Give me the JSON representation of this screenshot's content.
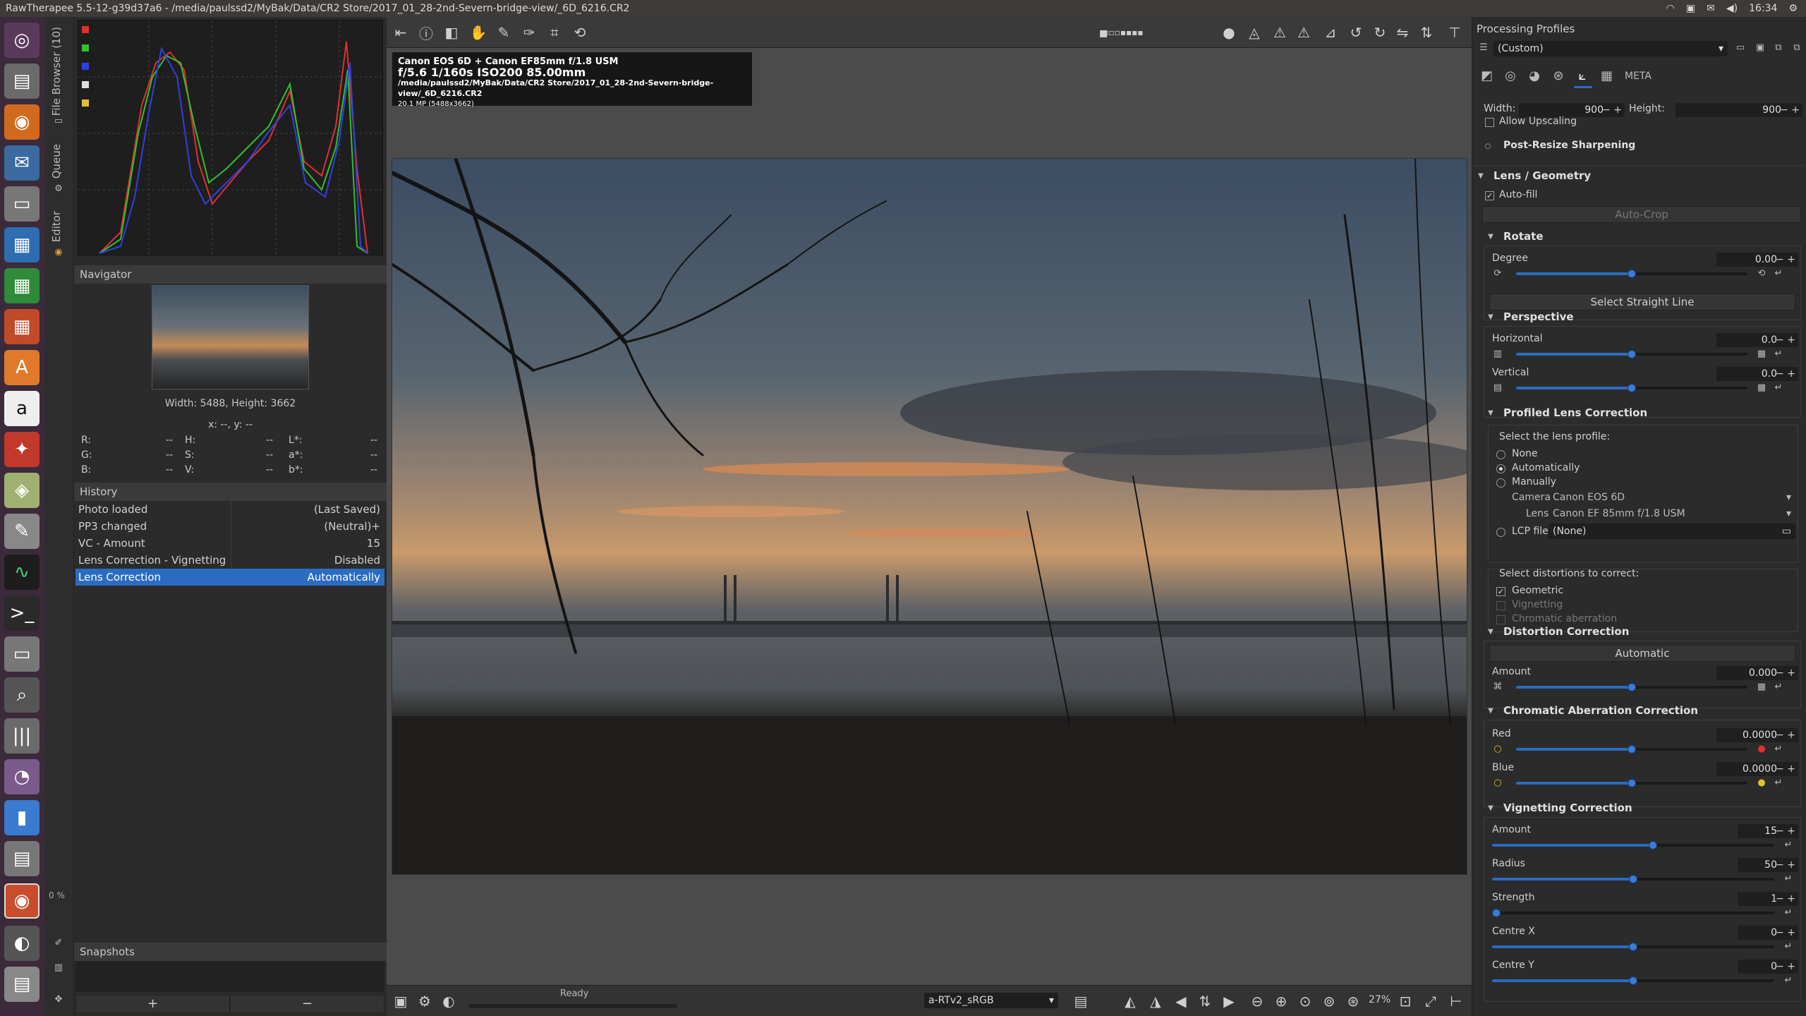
{
  "window": {
    "title": "RawTherapee 5.5-12-g39d37a6 - /media/paulssd2/MyBak/Data/CR2 Store/2017_01_28-2nd-Severn-bridge-view/_6D_6216.CR2",
    "clock": "16:34"
  },
  "vtabs": {
    "file_browser": "File Browser (10)",
    "queue": "Queue",
    "editor": "Editor",
    "percent": "0 %"
  },
  "navigator": {
    "header": "Navigator",
    "size": "Width: 5488, Height: 3662",
    "xy": "x: --, y: --",
    "rgb": [
      {
        "l1": "R:",
        "v1": "--",
        "l2": "H:",
        "v2": "--",
        "l3": "L*:",
        "v3": "--"
      },
      {
        "l1": "G:",
        "v1": "--",
        "l2": "S:",
        "v2": "--",
        "l3": "a*:",
        "v3": "--"
      },
      {
        "l1": "B:",
        "v1": "--",
        "l2": "V:",
        "v2": "--",
        "l3": "b*:",
        "v3": "--"
      }
    ]
  },
  "history": {
    "header": "History",
    "rows": [
      {
        "action": "Photo loaded",
        "value": "(Last Saved)"
      },
      {
        "action": "PP3 changed",
        "value": "(Neutral)+"
      },
      {
        "action": "VC - Amount",
        "value": "15"
      },
      {
        "action": "Lens Correction - Vignetting",
        "value": "Disabled"
      },
      {
        "action": "Lens Correction",
        "value": "Automatically"
      }
    ]
  },
  "snapshots": {
    "header": "Snapshots",
    "add": "+",
    "remove": "−"
  },
  "exif": {
    "camera": "Canon EOS 6D + Canon EF85mm f/1.8 USM",
    "aperture": "f/5.6",
    "shutter": "1/160s",
    "iso": "ISO200",
    "focal": "85.00mm",
    "path": "/media/paulssd2/MyBak/Data/CR2 Store/2017_01_28-2nd-Severn-bridge-view/_6D_6216.CR2",
    "mp": "20.1 MP (5488x3662)"
  },
  "statusbar": {
    "status": "Ready",
    "profile": "a-RTv2_sRGB",
    "zoom": "27%"
  },
  "right": {
    "title": "Processing Profiles",
    "profile": "(Custom)",
    "resize": {
      "width_label": "Width:",
      "width": "900",
      "height_label": "Height:",
      "height": "900",
      "allow_upscaling": "Allow Upscaling",
      "post_resize": "Post-Resize Sharpening"
    },
    "lens_geometry": {
      "header": "Lens / Geometry",
      "autofill": "Auto-fill",
      "autocrop": "Auto-Crop"
    },
    "rotate": {
      "header": "Rotate",
      "degree_label": "Degree",
      "degree": "0.00",
      "straight": "Select Straight Line"
    },
    "perspective": {
      "header": "Perspective",
      "h_label": "Horizontal",
      "h": "0.0",
      "v_label": "Vertical",
      "v": "0.0"
    },
    "plc": {
      "header": "Profiled Lens Correction",
      "select_profile": "Select the lens profile:",
      "none": "None",
      "auto": "Automatically",
      "manual": "Manually",
      "camera_label": "Camera",
      "camera": "Canon EOS 6D",
      "lens_label": "Lens",
      "lens": "Canon EF 85mm f/1.8 USM",
      "lcp_label": "LCP file",
      "lcp": "(None)",
      "distortions": "Select distortions to correct:",
      "geometric": "Geometric",
      "vignetting": "Vignetting",
      "ca": "Chromatic aberration"
    },
    "distortion": {
      "header": "Distortion Correction",
      "auto": "Automatic",
      "amount_label": "Amount",
      "amount": "0.000"
    },
    "cac": {
      "header": "Chromatic Aberration Correction",
      "red_label": "Red",
      "red": "0.0000",
      "blue_label": "Blue",
      "blue": "0.0000"
    },
    "vignetting": {
      "header": "Vignetting Correction",
      "amount_label": "Amount",
      "amount": "15",
      "radius_label": "Radius",
      "radius": "50",
      "strength_label": "Strength",
      "strength": "1",
      "cx_label": "Centre X",
      "cx": "0",
      "cy_label": "Centre Y",
      "cy": "0"
    }
  }
}
